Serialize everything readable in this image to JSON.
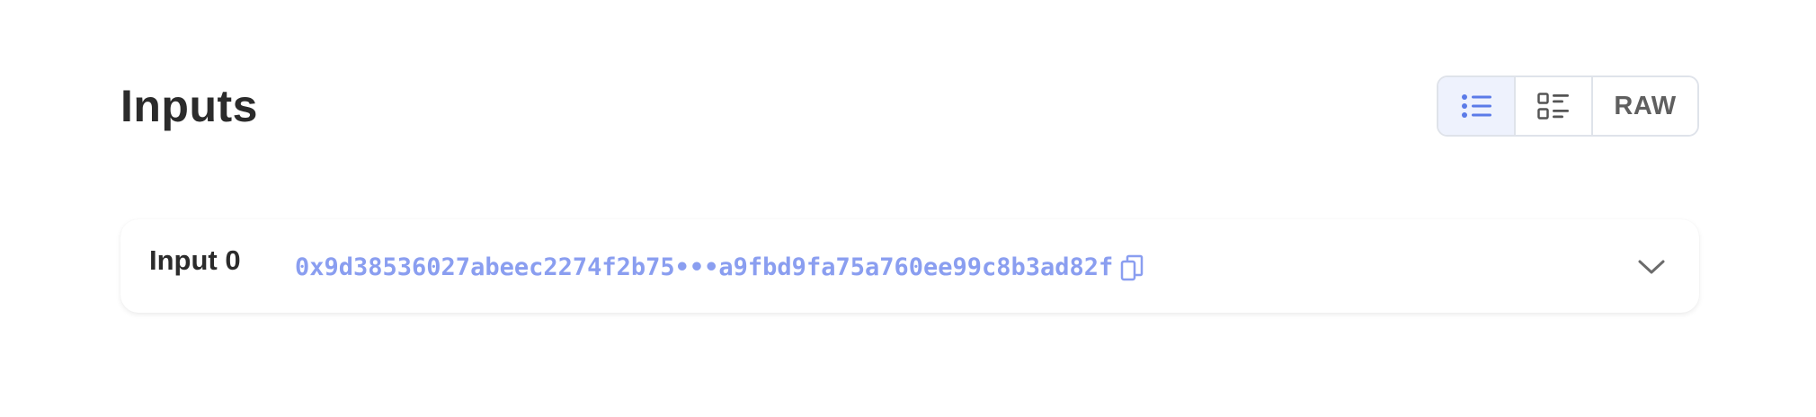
{
  "section": {
    "title": "Inputs"
  },
  "view_toggle": {
    "options": [
      {
        "icon": "bullet-list-icon",
        "active": true
      },
      {
        "icon": "detailed-list-icon",
        "active": false
      },
      {
        "label": "RAW",
        "active": false
      }
    ]
  },
  "inputs": [
    {
      "label": "Input 0",
      "hash": "0x9d38536027abeec2274f2b75•••a9fbd9fa75a760ee99c8b3ad82f"
    }
  ],
  "colors": {
    "accent": "#5b7be8",
    "hash_text": "#8a9ef0",
    "active_bg": "#eef2fd",
    "border": "#dfe3ea"
  }
}
